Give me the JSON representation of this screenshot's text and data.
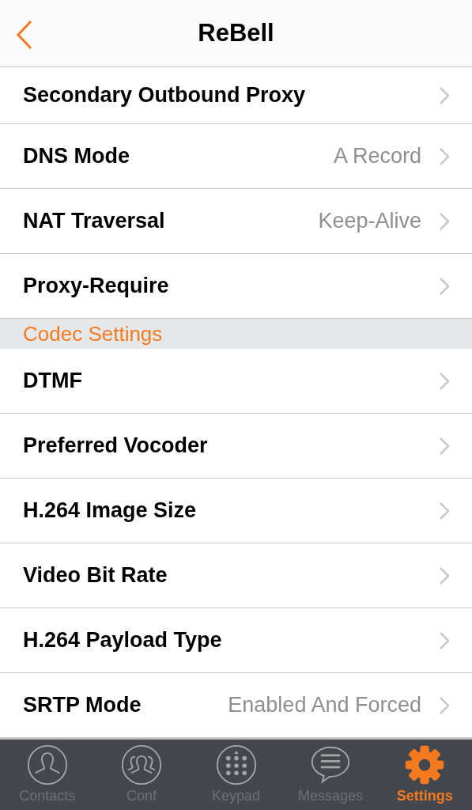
{
  "header": {
    "title": "ReBell"
  },
  "items": [
    {
      "kind": "row",
      "label": "Secondary Outbound Proxy"
    },
    {
      "kind": "row",
      "label": "DNS Mode",
      "value": "A Record"
    },
    {
      "kind": "row",
      "label": "NAT Traversal",
      "value": "Keep-Alive"
    },
    {
      "kind": "row",
      "label": "Proxy-Require"
    },
    {
      "kind": "section",
      "label": "Codec Settings"
    },
    {
      "kind": "row",
      "label": "DTMF"
    },
    {
      "kind": "row",
      "label": "Preferred Vocoder"
    },
    {
      "kind": "row",
      "label": "H.264 Image Size"
    },
    {
      "kind": "row",
      "label": "Video Bit Rate"
    },
    {
      "kind": "row",
      "label": "H.264 Payload Type"
    },
    {
      "kind": "row",
      "label": "SRTP Mode",
      "value": "Enabled And Forced"
    }
  ],
  "tabs": [
    {
      "label": "Contacts",
      "kind": "contacts",
      "selected": false
    },
    {
      "label": "Conf",
      "kind": "conf",
      "selected": false
    },
    {
      "label": "Keypad",
      "kind": "keypad",
      "selected": false
    },
    {
      "label": "Messages",
      "kind": "messages",
      "selected": false
    },
    {
      "label": "Settings",
      "kind": "settings",
      "selected": true
    }
  ]
}
